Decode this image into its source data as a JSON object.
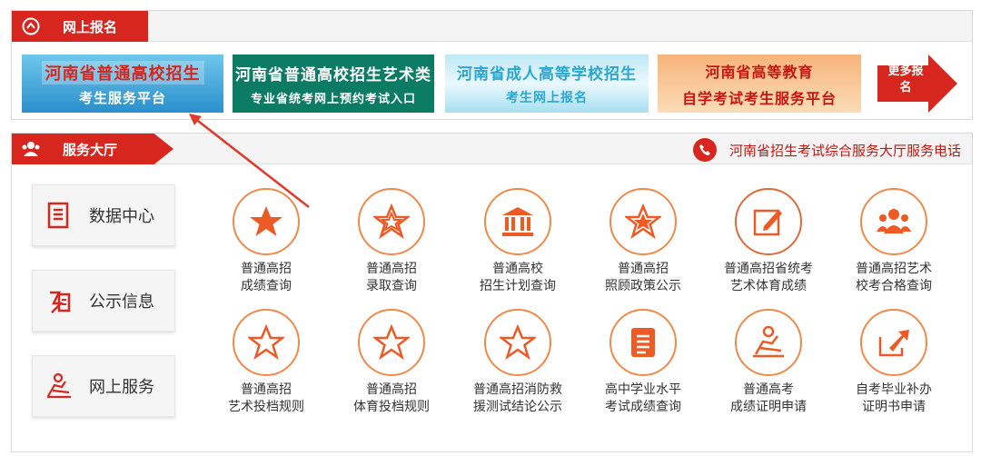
{
  "section_register": {
    "title": "网上报名",
    "banners": [
      {
        "line1": "河南省普通高校招生",
        "line2": "考生服务平台"
      },
      {
        "line1": "河南省普通高校招生艺术类",
        "line2": "专业省统考网上预约考试入口"
      },
      {
        "line1": "河南省成人高等学校招生",
        "line2": "考生网上报名"
      },
      {
        "line1": "河南省高等教育",
        "line2": "自学考试考生服务平台"
      }
    ],
    "more_label": "更多报名"
  },
  "section_service": {
    "title": "服务大厅",
    "hotline": "河南省招生考试综合服务大厅服务电话",
    "side": [
      {
        "label": "数据中心",
        "icon": "document-list-icon"
      },
      {
        "label": "公示信息",
        "icon": "notice-icon"
      },
      {
        "label": "网上服务",
        "icon": "person-desk-icon"
      }
    ],
    "items": [
      {
        "label": "普通高招\n成绩查询",
        "icon": "star-solid-icon"
      },
      {
        "label": "普通高招\n录取查询",
        "icon": "star-outline-icon"
      },
      {
        "label": "普通高校\n招生计划查询",
        "icon": "building-icon"
      },
      {
        "label": "普通高招\n照顾政策公示",
        "icon": "star-outline-icon"
      },
      {
        "label": "普通高招省统考\n艺术体育成绩",
        "icon": "edit-icon"
      },
      {
        "label": "普通高招艺术\n校考合格查询",
        "icon": "group-icon"
      },
      {
        "label": "普通高招\n艺术投档规则",
        "icon": "star-outline-icon"
      },
      {
        "label": "普通高招\n体育投档规则",
        "icon": "star-outline-icon"
      },
      {
        "label": "普通高招消防救\n援测试结论公示",
        "icon": "star-outline-icon"
      },
      {
        "label": "高中学业水平\n考试成绩查询",
        "icon": "report-icon"
      },
      {
        "label": "普通高考\n成绩证明申请",
        "icon": "person-desk-icon"
      },
      {
        "label": "自考毕业补办\n证明书申请",
        "icon": "export-icon"
      }
    ]
  },
  "colors": {
    "brand_red": "#d7261e",
    "accent_orange": "#f08a4b"
  }
}
